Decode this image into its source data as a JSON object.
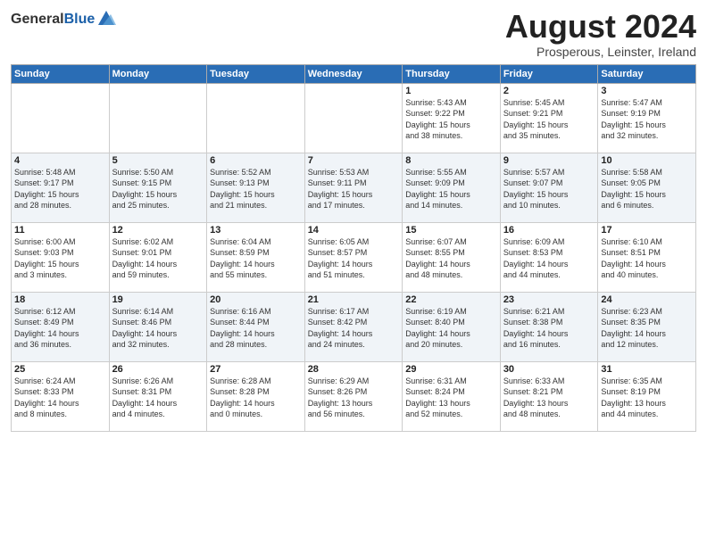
{
  "header": {
    "logo_general": "General",
    "logo_blue": "Blue",
    "month": "August 2024",
    "location": "Prosperous, Leinster, Ireland"
  },
  "weekdays": [
    "Sunday",
    "Monday",
    "Tuesday",
    "Wednesday",
    "Thursday",
    "Friday",
    "Saturday"
  ],
  "weeks": [
    [
      {
        "day": "",
        "info": ""
      },
      {
        "day": "",
        "info": ""
      },
      {
        "day": "",
        "info": ""
      },
      {
        "day": "",
        "info": ""
      },
      {
        "day": "1",
        "info": "Sunrise: 5:43 AM\nSunset: 9:22 PM\nDaylight: 15 hours\nand 38 minutes."
      },
      {
        "day": "2",
        "info": "Sunrise: 5:45 AM\nSunset: 9:21 PM\nDaylight: 15 hours\nand 35 minutes."
      },
      {
        "day": "3",
        "info": "Sunrise: 5:47 AM\nSunset: 9:19 PM\nDaylight: 15 hours\nand 32 minutes."
      }
    ],
    [
      {
        "day": "4",
        "info": "Sunrise: 5:48 AM\nSunset: 9:17 PM\nDaylight: 15 hours\nand 28 minutes."
      },
      {
        "day": "5",
        "info": "Sunrise: 5:50 AM\nSunset: 9:15 PM\nDaylight: 15 hours\nand 25 minutes."
      },
      {
        "day": "6",
        "info": "Sunrise: 5:52 AM\nSunset: 9:13 PM\nDaylight: 15 hours\nand 21 minutes."
      },
      {
        "day": "7",
        "info": "Sunrise: 5:53 AM\nSunset: 9:11 PM\nDaylight: 15 hours\nand 17 minutes."
      },
      {
        "day": "8",
        "info": "Sunrise: 5:55 AM\nSunset: 9:09 PM\nDaylight: 15 hours\nand 14 minutes."
      },
      {
        "day": "9",
        "info": "Sunrise: 5:57 AM\nSunset: 9:07 PM\nDaylight: 15 hours\nand 10 minutes."
      },
      {
        "day": "10",
        "info": "Sunrise: 5:58 AM\nSunset: 9:05 PM\nDaylight: 15 hours\nand 6 minutes."
      }
    ],
    [
      {
        "day": "11",
        "info": "Sunrise: 6:00 AM\nSunset: 9:03 PM\nDaylight: 15 hours\nand 3 minutes."
      },
      {
        "day": "12",
        "info": "Sunrise: 6:02 AM\nSunset: 9:01 PM\nDaylight: 14 hours\nand 59 minutes."
      },
      {
        "day": "13",
        "info": "Sunrise: 6:04 AM\nSunset: 8:59 PM\nDaylight: 14 hours\nand 55 minutes."
      },
      {
        "day": "14",
        "info": "Sunrise: 6:05 AM\nSunset: 8:57 PM\nDaylight: 14 hours\nand 51 minutes."
      },
      {
        "day": "15",
        "info": "Sunrise: 6:07 AM\nSunset: 8:55 PM\nDaylight: 14 hours\nand 48 minutes."
      },
      {
        "day": "16",
        "info": "Sunrise: 6:09 AM\nSunset: 8:53 PM\nDaylight: 14 hours\nand 44 minutes."
      },
      {
        "day": "17",
        "info": "Sunrise: 6:10 AM\nSunset: 8:51 PM\nDaylight: 14 hours\nand 40 minutes."
      }
    ],
    [
      {
        "day": "18",
        "info": "Sunrise: 6:12 AM\nSunset: 8:49 PM\nDaylight: 14 hours\nand 36 minutes."
      },
      {
        "day": "19",
        "info": "Sunrise: 6:14 AM\nSunset: 8:46 PM\nDaylight: 14 hours\nand 32 minutes."
      },
      {
        "day": "20",
        "info": "Sunrise: 6:16 AM\nSunset: 8:44 PM\nDaylight: 14 hours\nand 28 minutes."
      },
      {
        "day": "21",
        "info": "Sunrise: 6:17 AM\nSunset: 8:42 PM\nDaylight: 14 hours\nand 24 minutes."
      },
      {
        "day": "22",
        "info": "Sunrise: 6:19 AM\nSunset: 8:40 PM\nDaylight: 14 hours\nand 20 minutes."
      },
      {
        "day": "23",
        "info": "Sunrise: 6:21 AM\nSunset: 8:38 PM\nDaylight: 14 hours\nand 16 minutes."
      },
      {
        "day": "24",
        "info": "Sunrise: 6:23 AM\nSunset: 8:35 PM\nDaylight: 14 hours\nand 12 minutes."
      }
    ],
    [
      {
        "day": "25",
        "info": "Sunrise: 6:24 AM\nSunset: 8:33 PM\nDaylight: 14 hours\nand 8 minutes."
      },
      {
        "day": "26",
        "info": "Sunrise: 6:26 AM\nSunset: 8:31 PM\nDaylight: 14 hours\nand 4 minutes."
      },
      {
        "day": "27",
        "info": "Sunrise: 6:28 AM\nSunset: 8:28 PM\nDaylight: 14 hours\nand 0 minutes."
      },
      {
        "day": "28",
        "info": "Sunrise: 6:29 AM\nSunset: 8:26 PM\nDaylight: 13 hours\nand 56 minutes."
      },
      {
        "day": "29",
        "info": "Sunrise: 6:31 AM\nSunset: 8:24 PM\nDaylight: 13 hours\nand 52 minutes."
      },
      {
        "day": "30",
        "info": "Sunrise: 6:33 AM\nSunset: 8:21 PM\nDaylight: 13 hours\nand 48 minutes."
      },
      {
        "day": "31",
        "info": "Sunrise: 6:35 AM\nSunset: 8:19 PM\nDaylight: 13 hours\nand 44 minutes."
      }
    ]
  ]
}
